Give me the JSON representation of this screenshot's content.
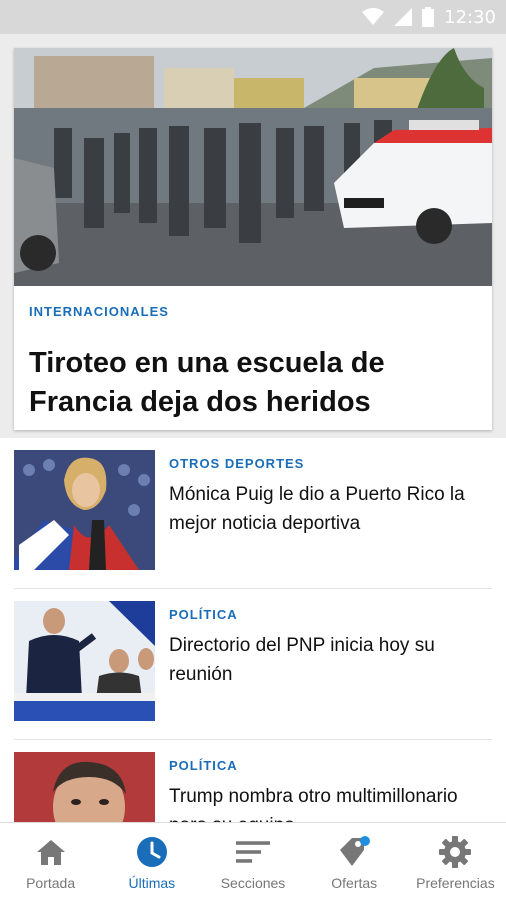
{
  "status_bar": {
    "time": "12:30"
  },
  "hero": {
    "section": "INTERNACIONALES",
    "headline": "Tiroteo en una escuela de Francia deja dos heridos"
  },
  "articles": [
    {
      "section": "OTROS DEPORTES",
      "headline": "Mónica Puig le dio a Puerto Rico la mejor noticia deportiva"
    },
    {
      "section": "POLÍTICA",
      "headline": "Directorio del PNP inicia hoy su reunión"
    },
    {
      "section": "POLÍTICA",
      "headline": "Trump nombra otro multimillonario para su equipo"
    }
  ],
  "bottom_nav": [
    {
      "label": "Portada",
      "icon": "home-icon",
      "active": false
    },
    {
      "label": "Últimas",
      "icon": "clock-icon",
      "active": true
    },
    {
      "label": "Secciones",
      "icon": "sections-icon",
      "active": false
    },
    {
      "label": "Ofertas",
      "icon": "tag-icon",
      "active": false
    },
    {
      "label": "Preferencias",
      "icon": "gear-icon",
      "active": false
    }
  ],
  "colors": {
    "accent": "#1a6db8",
    "notification_dot": "#1e8fe0"
  }
}
